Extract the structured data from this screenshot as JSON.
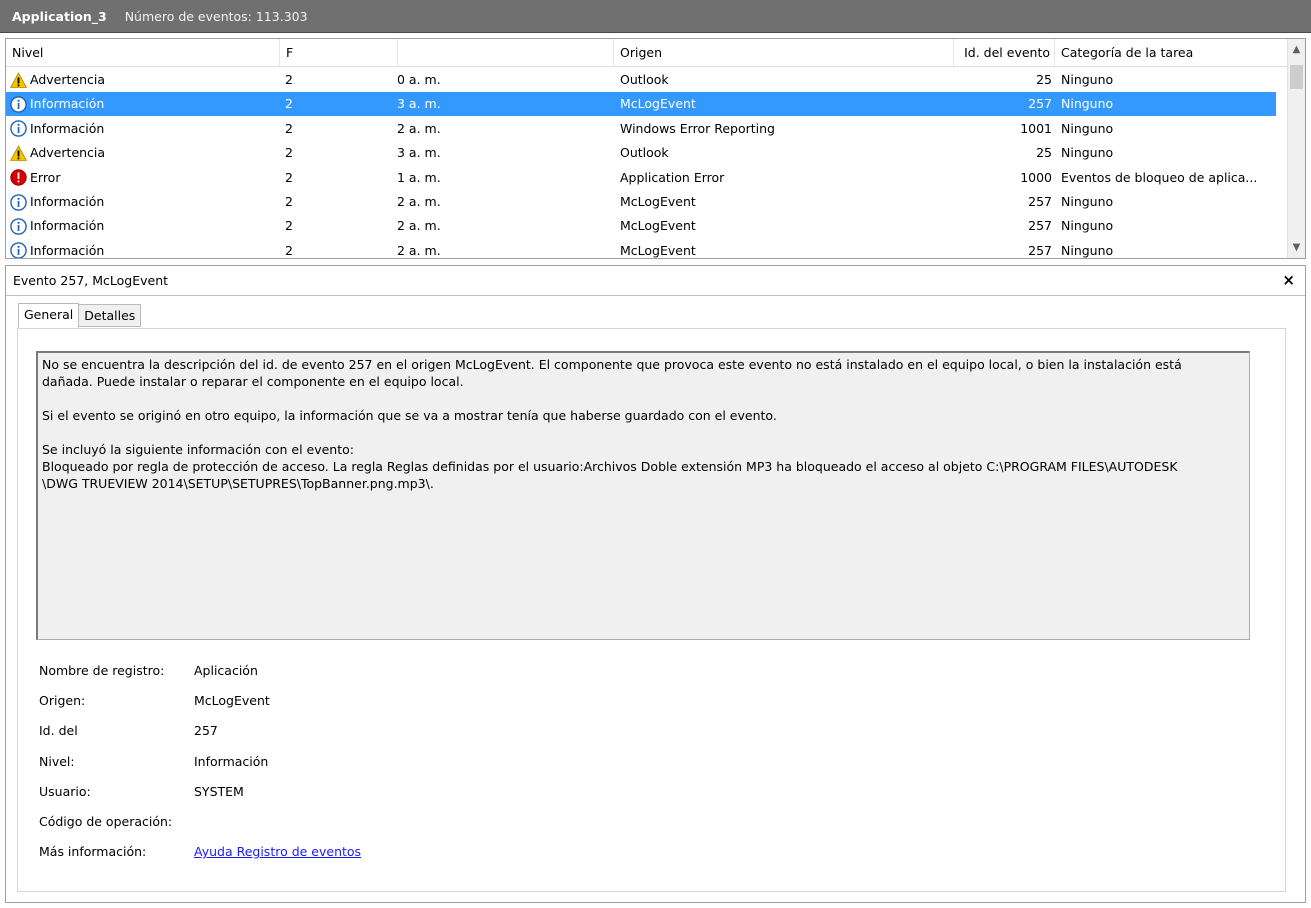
{
  "window": {
    "app_name": "Application_3",
    "event_count": "Número de eventos: 113.303"
  },
  "columns": {
    "level": "Nivel",
    "date": "F",
    "time": "",
    "source": "Origen",
    "event_id": "Id. del evento",
    "category": "Categoría de la tarea"
  },
  "rows": [
    {
      "icon": "warning",
      "level": "Advertencia",
      "date": "2",
      "time": "0 a. m.",
      "source": "Outlook",
      "event_id": "25",
      "category": "Ninguno"
    },
    {
      "icon": "info",
      "level": "Información",
      "date": "2",
      "time": "3 a. m.",
      "source": "McLogEvent",
      "event_id": "257",
      "category": "Ninguno"
    },
    {
      "icon": "info",
      "level": "Información",
      "date": "2",
      "time": "2 a. m.",
      "source": "Windows Error Reporting",
      "event_id": "1001",
      "category": "Ninguno"
    },
    {
      "icon": "warning",
      "level": "Advertencia",
      "date": "2",
      "time": "3 a. m.",
      "source": "Outlook",
      "event_id": "25",
      "category": "Ninguno"
    },
    {
      "icon": "error",
      "level": "Error",
      "date": "2",
      "time": "1 a. m.",
      "source": "Application Error",
      "event_id": "1000",
      "category": "Eventos de bloqueo de aplica..."
    },
    {
      "icon": "info",
      "level": "Información",
      "date": "2",
      "time": "2 a. m.",
      "source": "McLogEvent",
      "event_id": "257",
      "category": "Ninguno"
    },
    {
      "icon": "info",
      "level": "Información",
      "date": "2",
      "time": "2 a. m.",
      "source": "McLogEvent",
      "event_id": "257",
      "category": "Ninguno"
    },
    {
      "icon": "info",
      "level": "Información",
      "date": "2",
      "time": "2 a. m.",
      "source": "McLogEvent",
      "event_id": "257",
      "category": "Ninguno"
    }
  ],
  "selected_row": 1,
  "details": {
    "title": "Evento 257, McLogEvent",
    "close_glyph": "×",
    "tabs": [
      "General",
      "Detalles"
    ],
    "active_tab": 0,
    "description": {
      "p1_line1": "No se encuentra la descripción del id. de evento 257 en el origen McLogEvent. El componente que provoca este evento no está instalado en el equipo local, o bien la instalación está",
      "p1_line2": "dañada. Puede instalar o reparar el componente en el equipo local.",
      "p2": "Si el evento se originó en otro equipo, la información que se va a mostrar tenía que haberse guardado con el evento.",
      "p3_line1": "Se incluyó la siguiente información con el evento:",
      "p3_line2": "Bloqueado por regla de protección de acceso.  La regla Reglas definidas por el usuario:Archivos Doble extensión MP3 ha bloqueado el acceso al objeto C:\\PROGRAM FILES\\AUTODESK",
      "p3_line3": "\\DWG TRUEVIEW 2014\\SETUP\\SETUPRES\\TopBanner.png.mp3\\."
    },
    "properties": [
      {
        "key": "Nombre de registro:",
        "value": "Aplicación"
      },
      {
        "key": "Origen:",
        "value": "McLogEvent"
      },
      {
        "key": "Id. del",
        "value": "257"
      },
      {
        "key": "Nivel:",
        "value": "Información"
      },
      {
        "key": "Usuario:",
        "value": "SYSTEM"
      },
      {
        "key": "Código de operación:",
        "value": ""
      },
      {
        "key": "Más información:",
        "value": "Ayuda Registro de eventos",
        "is_link": true
      }
    ]
  },
  "colors": {
    "titlebar": "#707070",
    "selection": "#3399ff",
    "warning": "#f5c400",
    "info": "#1e63b4",
    "error": "#d40000"
  }
}
